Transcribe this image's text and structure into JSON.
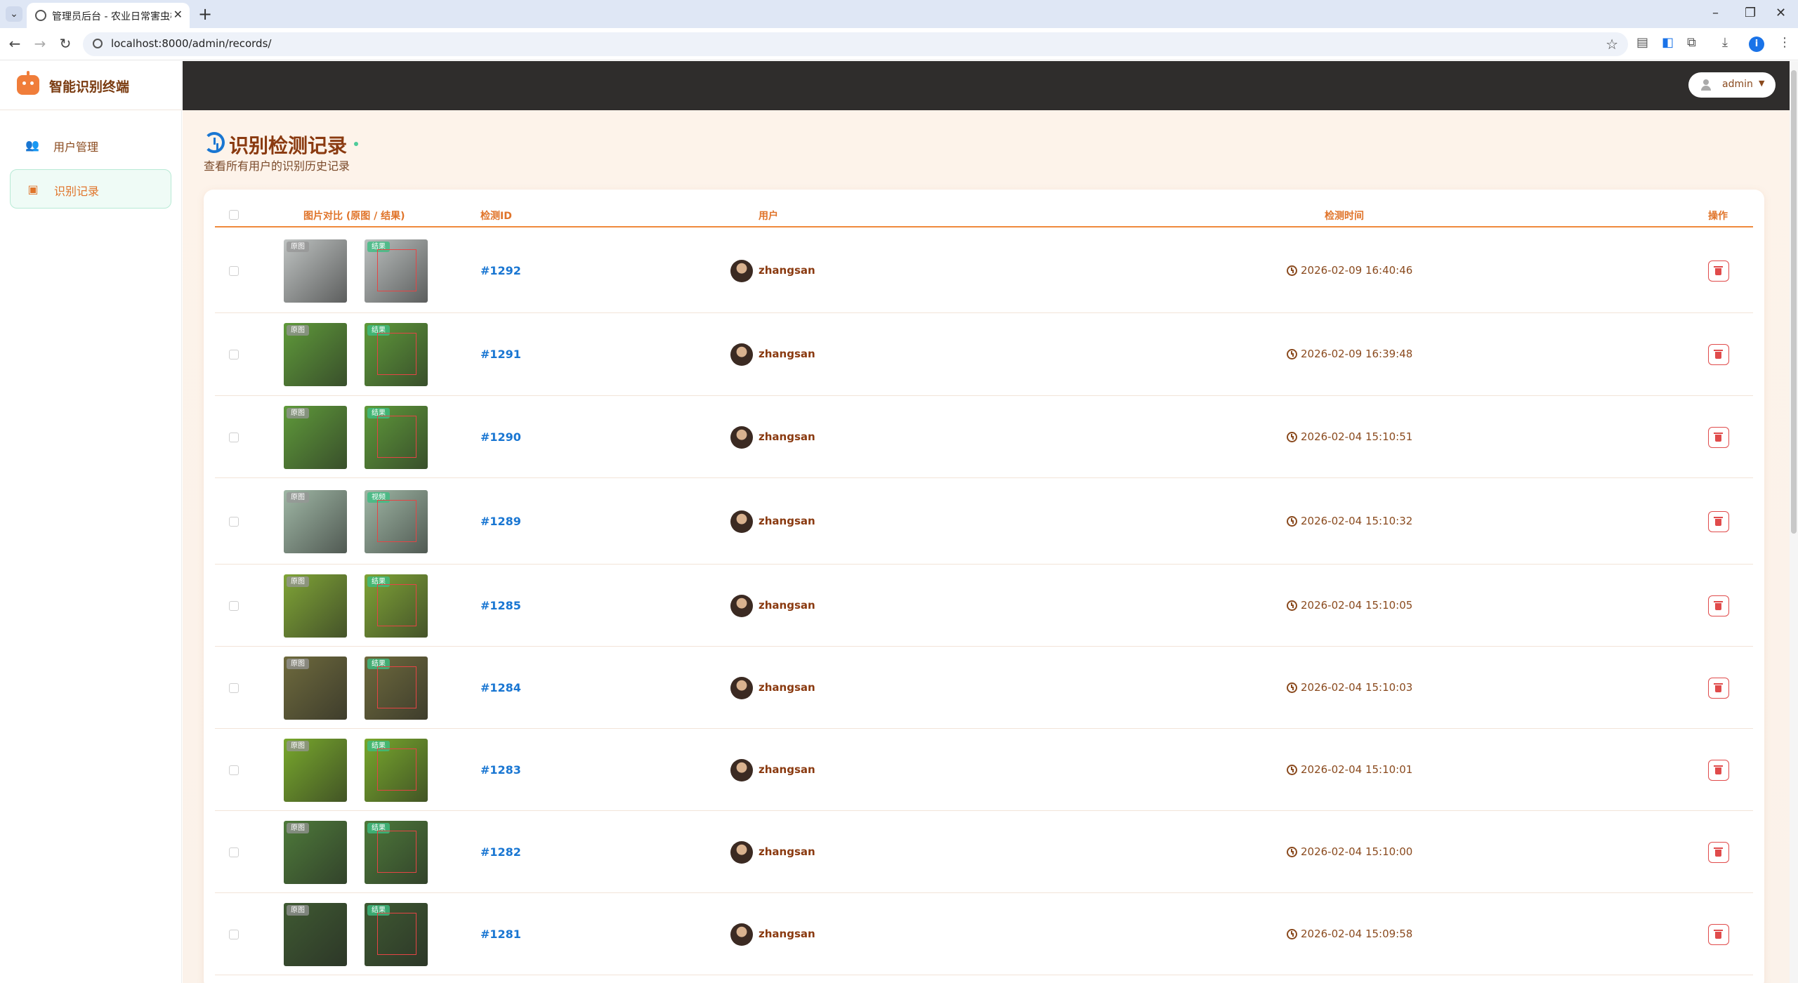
{
  "browser": {
    "tab_title": "管理员后台 - 农业日常害虫检测",
    "url": "localhost:8000/admin/records/",
    "profile_initial": "i"
  },
  "sidebar": {
    "brand": "智能识别终端",
    "items": [
      {
        "label": "用户管理",
        "icon": "users-icon"
      },
      {
        "label": "识别记录",
        "icon": "clipboard-icon",
        "active": true
      }
    ]
  },
  "header": {
    "username": "admin"
  },
  "page": {
    "title": "识别检测记录",
    "subtitle": "查看所有用户的识别历史记录"
  },
  "table": {
    "columns": {
      "images": "图片对比 (原图 / 结果)",
      "id": "检测ID",
      "user": "用户",
      "time": "检测时间",
      "actions": "操作"
    },
    "tags": {
      "original": "原图",
      "result": "结果",
      "video": "视频"
    },
    "rows": [
      {
        "id": "#1292",
        "user": "zhangsan",
        "time": "2026-02-09 16:40:46",
        "orig_color": "#bfc3c2",
        "res_color": "#bcc1c0",
        "res_tag": "result"
      },
      {
        "id": "#1291",
        "user": "zhangsan",
        "time": "2026-02-09 16:39:48",
        "orig_color": "#5f9a3a",
        "res_color": "#5f9a3a",
        "res_tag": "result"
      },
      {
        "id": "#1290",
        "user": "zhangsan",
        "time": "2026-02-04 15:10:51",
        "orig_color": "#5f9a3a",
        "res_color": "#5f9a3a",
        "res_tag": "result"
      },
      {
        "id": "#1289",
        "user": "zhangsan",
        "time": "2026-02-04 15:10:32",
        "orig_color": "#9fb7a5",
        "res_color": "#9fb7a5",
        "res_tag": "video"
      },
      {
        "id": "#1285",
        "user": "zhangsan",
        "time": "2026-02-04 15:10:05",
        "orig_color": "#7fa436",
        "res_color": "#7fa436",
        "res_tag": "result"
      },
      {
        "id": "#1284",
        "user": "zhangsan",
        "time": "2026-02-04 15:10:03",
        "orig_color": "#6e6a3d",
        "res_color": "#6e6a3d",
        "res_tag": "result"
      },
      {
        "id": "#1283",
        "user": "zhangsan",
        "time": "2026-02-04 15:10:01",
        "orig_color": "#78a82c",
        "res_color": "#78a82c",
        "res_tag": "result"
      },
      {
        "id": "#1282",
        "user": "zhangsan",
        "time": "2026-02-04 15:10:00",
        "orig_color": "#4e7a3a",
        "res_color": "#4e7a3a",
        "res_tag": "result"
      },
      {
        "id": "#1281",
        "user": "zhangsan",
        "time": "2026-02-04 15:09:58",
        "orig_color": "#3f5a32",
        "res_color": "#3f5a32",
        "res_tag": "result"
      }
    ]
  },
  "colors": {
    "accent": "#e0742a",
    "topbar": "#2f2d2c",
    "link": "#1976d2",
    "danger": "#e04b4b"
  }
}
